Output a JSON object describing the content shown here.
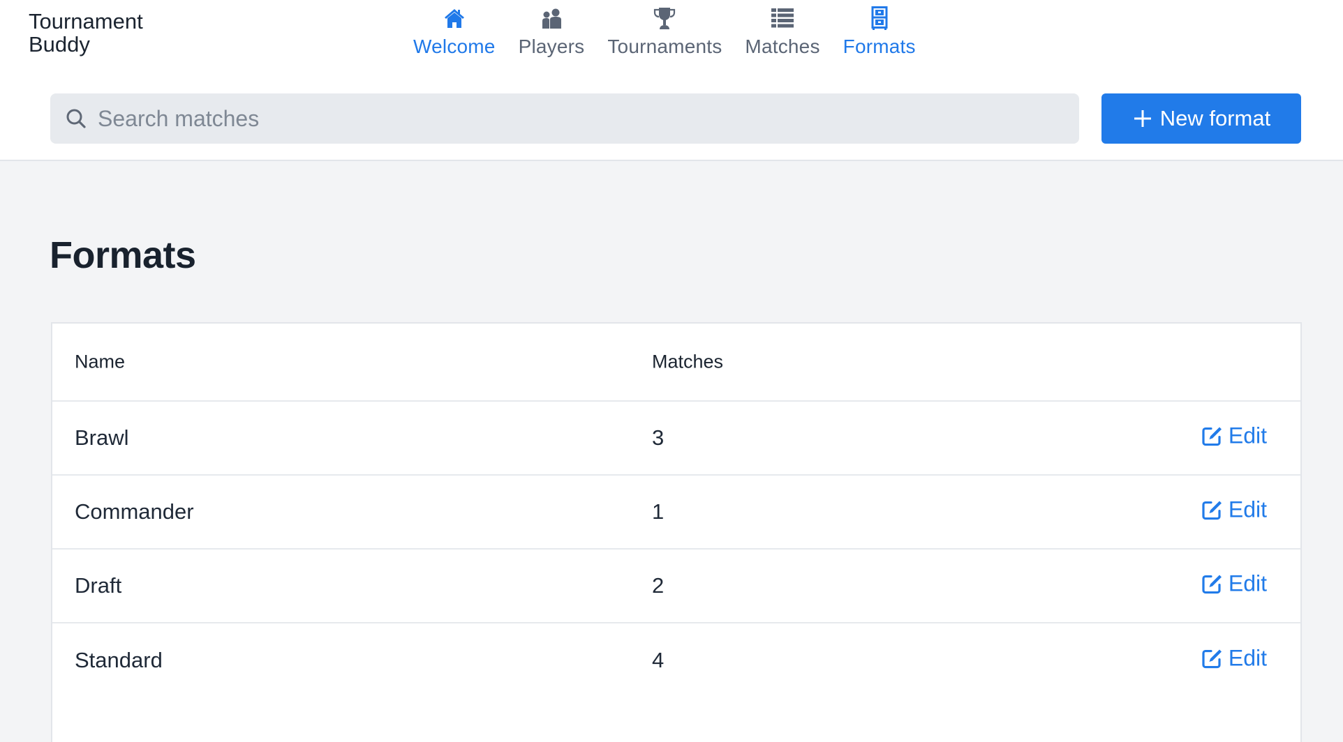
{
  "app": {
    "title_line1": "Tournament",
    "title_line2": "Buddy"
  },
  "nav": {
    "items": [
      {
        "label": "Welcome",
        "icon": "home-icon",
        "active": true
      },
      {
        "label": "Players",
        "icon": "users-icon",
        "active": false
      },
      {
        "label": "Tournaments",
        "icon": "trophy-icon",
        "active": false
      },
      {
        "label": "Matches",
        "icon": "list-icon",
        "active": false
      },
      {
        "label": "Formats",
        "icon": "filing-cabinet-icon",
        "active": true
      }
    ]
  },
  "search": {
    "placeholder": "Search matches",
    "value": ""
  },
  "toolbar": {
    "new_label": "New format"
  },
  "page": {
    "title": "Formats"
  },
  "table": {
    "columns": [
      "Name",
      "Matches"
    ],
    "edit_label": "Edit",
    "rows": [
      {
        "name": "Brawl",
        "matches": "3"
      },
      {
        "name": "Commander",
        "matches": "1"
      },
      {
        "name": "Draft",
        "matches": "2"
      },
      {
        "name": "Standard",
        "matches": "4"
      }
    ]
  },
  "colors": {
    "accent": "#217be9",
    "nav_inactive": "#5b6575",
    "background": "#f3f4f6",
    "search_bg": "#e7eaee"
  }
}
